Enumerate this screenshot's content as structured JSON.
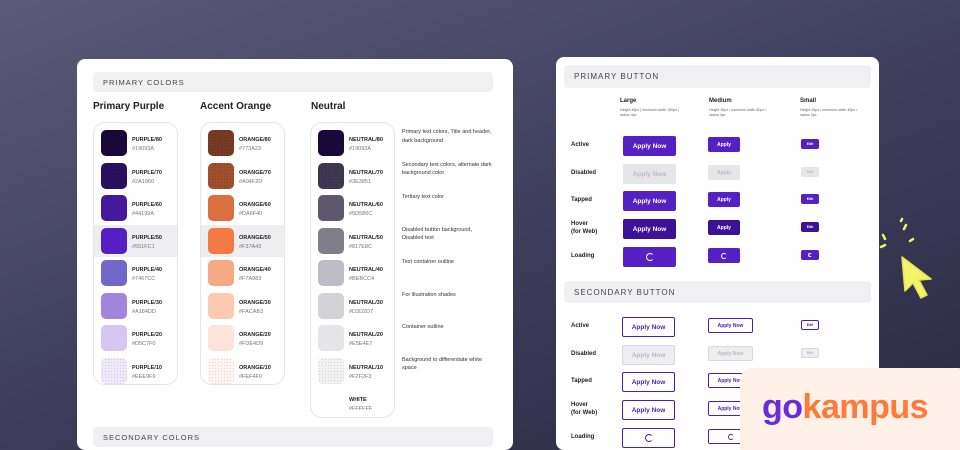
{
  "colors_card": {
    "primary_section": "PRIMARY COLORS",
    "secondary_section": "SECONDARY COLORS",
    "groups": [
      {
        "title": "Primary Purple",
        "swatches": [
          {
            "name": "PURPLE/80",
            "hex": "#19093A"
          },
          {
            "name": "PURPLE/70",
            "hex": "#2A1060"
          },
          {
            "name": "PURPLE/60",
            "hex": "#44199A"
          },
          {
            "name": "PURPLE/50",
            "hex": "#551FC1"
          },
          {
            "name": "PURPLE/40",
            "hex": "#7467CC"
          },
          {
            "name": "PURPLE/30",
            "hex": "#A184DD"
          },
          {
            "name": "PURPLE/20",
            "hex": "#D5C7F0"
          },
          {
            "name": "PURPLE/10",
            "hex": "#EEE9F9"
          }
        ]
      },
      {
        "title": "Accent Orange",
        "swatches": [
          {
            "name": "ORANGE/80",
            "hex": "#773A23"
          },
          {
            "name": "ORANGE/70",
            "hex": "#A04F2D"
          },
          {
            "name": "ORANGE/60",
            "hex": "#DA6F40"
          },
          {
            "name": "ORANGE/50",
            "hex": "#F37A43"
          },
          {
            "name": "ORANGE/40",
            "hex": "#F7A983"
          },
          {
            "name": "ORANGE/30",
            "hex": "#FACAB3"
          },
          {
            "name": "ORANGE/20",
            "hex": "#FDE4D9"
          },
          {
            "name": "ORANGE/10",
            "hex": "#FEF4F0"
          }
        ]
      },
      {
        "title": "Neutral",
        "swatches": [
          {
            "name": "NEUTRAL/80",
            "hex": "#19093A",
            "desc": "Primary text colors, Title and header, dark background"
          },
          {
            "name": "NEUTRAL/70",
            "hex": "#3E3851",
            "desc": "Secondary text colors, alternate dark background color"
          },
          {
            "name": "NEUTRAL/60",
            "hex": "#5D586C",
            "desc": "Tertiary text color"
          },
          {
            "name": "NEUTRAL/50",
            "hex": "#817E8C",
            "desc": "Disabled button background, Disabled text"
          },
          {
            "name": "NEUTRAL/40",
            "hex": "#BEBCC4",
            "desc": "Text container outline"
          },
          {
            "name": "NEUTRAL/30",
            "hex": "#D3D2D7",
            "desc": "For illustration shades"
          },
          {
            "name": "NEUTRAL/20",
            "hex": "#E5E4E7",
            "desc": "Container outline"
          },
          {
            "name": "NEUTRAL/10",
            "hex": "#F2F2F3",
            "desc": "Background to differentiate white space"
          },
          {
            "name": "WHITE",
            "hex": "#FFFFFF"
          }
        ]
      }
    ]
  },
  "buttons_card": {
    "primary_section": "PRIMARY  BUTTON",
    "secondary_section": "SECONDARY BUTTON",
    "sizes": [
      {
        "label": "Large",
        "note": "Height 48px | minimum width 150px | radius 4px"
      },
      {
        "label": "Medium",
        "note": "Height 36px • minimum width 80px • radius 4px"
      },
      {
        "label": "Small",
        "note": "Height 26px • minimum width 40px • radius 3px"
      }
    ],
    "primary_states": [
      "Active",
      "Disabled",
      "Tapped",
      "Hover\n(for Web)",
      "Loading"
    ],
    "secondary_states": [
      "Active",
      "Disabled",
      "Tapped",
      "Hover\n(for Web)",
      "Loading"
    ],
    "large_label": "Apply Now",
    "medium_label": "Apply",
    "small_label": "Edit",
    "secondary_medium_label": "Apply Now"
  },
  "brand": {
    "go": "go",
    "kampus": "kampus"
  },
  "colors": {
    "brand_purple": "#5520C4",
    "brand_orange": "#FF7A38"
  }
}
